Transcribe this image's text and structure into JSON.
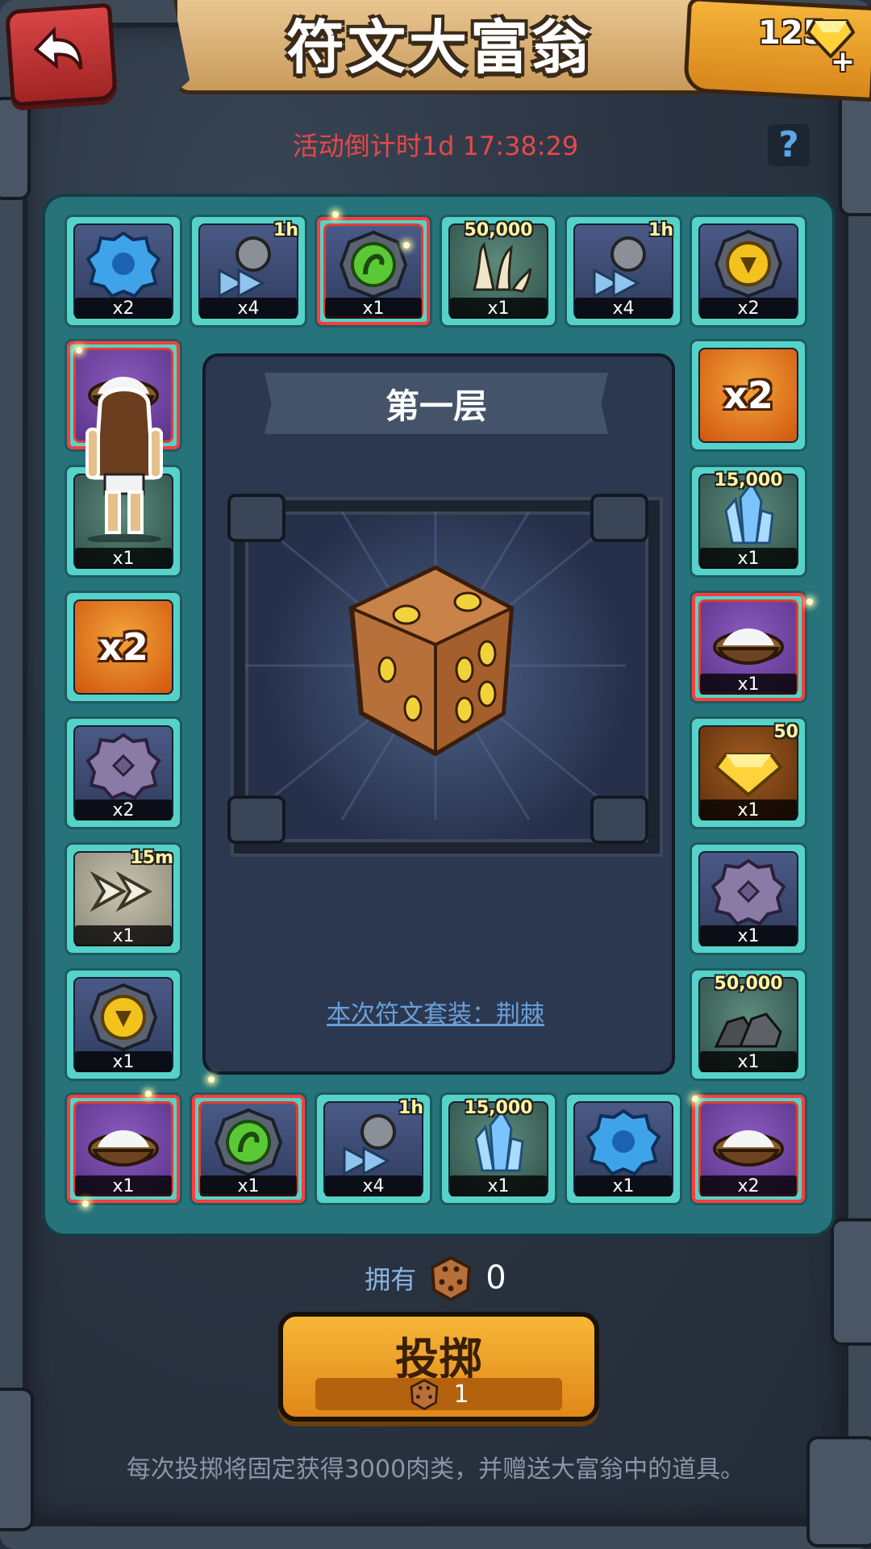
{
  "header": {
    "title": "符文大富翁",
    "gems": "125",
    "plus": "+"
  },
  "countdown": "活动倒计时1d 17:38:29",
  "help": "?",
  "board": {
    "floor_title": "第一层",
    "rune_set_link": "本次符文套装：荆棘",
    "tiles": [
      {
        "name": "blue-rune",
        "qty": "x2",
        "corner": ""
      },
      {
        "name": "speedup-1h",
        "qty": "x4",
        "corner": "1h"
      },
      {
        "name": "green-rune",
        "qty": "x1",
        "corner": ""
      },
      {
        "name": "claws-50000",
        "qty": "x1",
        "corner": "50,000"
      },
      {
        "name": "speedup-1h",
        "qty": "x4",
        "corner": "1h"
      },
      {
        "name": "yellow-rune",
        "qty": "x2",
        "corner": ""
      },
      {
        "name": "x2-multiplier",
        "label": "x2"
      },
      {
        "name": "crystal-15000",
        "qty": "x1",
        "corner": "15,000"
      },
      {
        "name": "salt-bowl",
        "qty": "x1",
        "corner": ""
      },
      {
        "name": "gold-gems-50",
        "qty": "x1",
        "corner": "50"
      },
      {
        "name": "purple-rune",
        "qty": "x1",
        "corner": ""
      },
      {
        "name": "coal-50000",
        "qty": "x1",
        "corner": "50,000"
      },
      {
        "name": "salt-bowl",
        "qty": "x2",
        "corner": ""
      },
      {
        "name": "blue-rune",
        "qty": "x1",
        "corner": ""
      },
      {
        "name": "crystal-15000",
        "qty": "x1",
        "corner": "15,000"
      },
      {
        "name": "speedup-1h",
        "qty": "x4",
        "corner": "1h"
      },
      {
        "name": "green-rune",
        "qty": "x1",
        "corner": ""
      },
      {
        "name": "salt-bowl",
        "qty": "x1",
        "corner": ""
      },
      {
        "name": "yellow-rune",
        "qty": "x1",
        "corner": ""
      },
      {
        "name": "speedup-15m",
        "qty": "x1",
        "corner": "15m"
      },
      {
        "name": "purple-rune",
        "qty": "x2",
        "corner": ""
      },
      {
        "name": "x2-multiplier",
        "label": "x2"
      },
      {
        "name": "hero-tile",
        "qty": "x1",
        "corner": ""
      },
      {
        "name": "salt-bowl",
        "qty": "",
        "corner": ""
      }
    ]
  },
  "owned": {
    "label": "拥有",
    "count": "0"
  },
  "roll": {
    "label": "投掷",
    "cost": "1"
  },
  "footer": "每次投掷将固定获得3000肉类，并赠送大富翁中的道具。",
  "colors": {
    "countdown": "#e54949",
    "board": "#26737b",
    "tile": "#55d3c8",
    "button": "#f7b636",
    "link": "#6a9fd8"
  }
}
